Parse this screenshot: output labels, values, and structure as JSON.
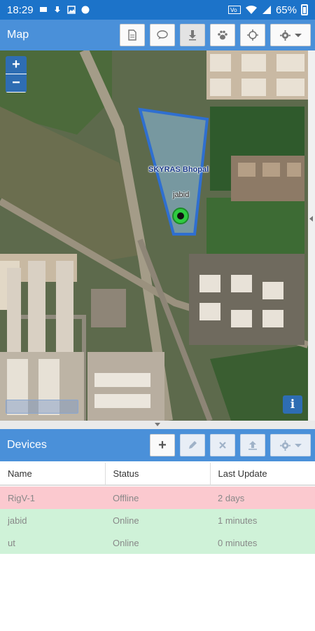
{
  "status_bar": {
    "time": "18:29",
    "battery": "65%"
  },
  "map_panel": {
    "title": "Map"
  },
  "map": {
    "zoom_in": "+",
    "zoom_out": "−",
    "geofence_label": "SKYRAS Bhopal",
    "device_label": "jabid",
    "info": "i"
  },
  "devices_panel": {
    "title": "Devices",
    "add": "+",
    "columns": [
      "Name",
      "Status",
      "Last Update"
    ],
    "rows": [
      {
        "name": "RigV-1",
        "status": "Offline",
        "last_update": "2 days"
      },
      {
        "name": "jabid",
        "status": "Online",
        "last_update": "1 minutes"
      },
      {
        "name": "ut",
        "status": "Online",
        "last_update": "0 minutes"
      }
    ]
  },
  "colors": {
    "header": "#4a90d9",
    "status_bar": "#1c73c9",
    "offline": "#fbc9cf",
    "online": "#cff2d8",
    "marker": "#2ecc40"
  }
}
